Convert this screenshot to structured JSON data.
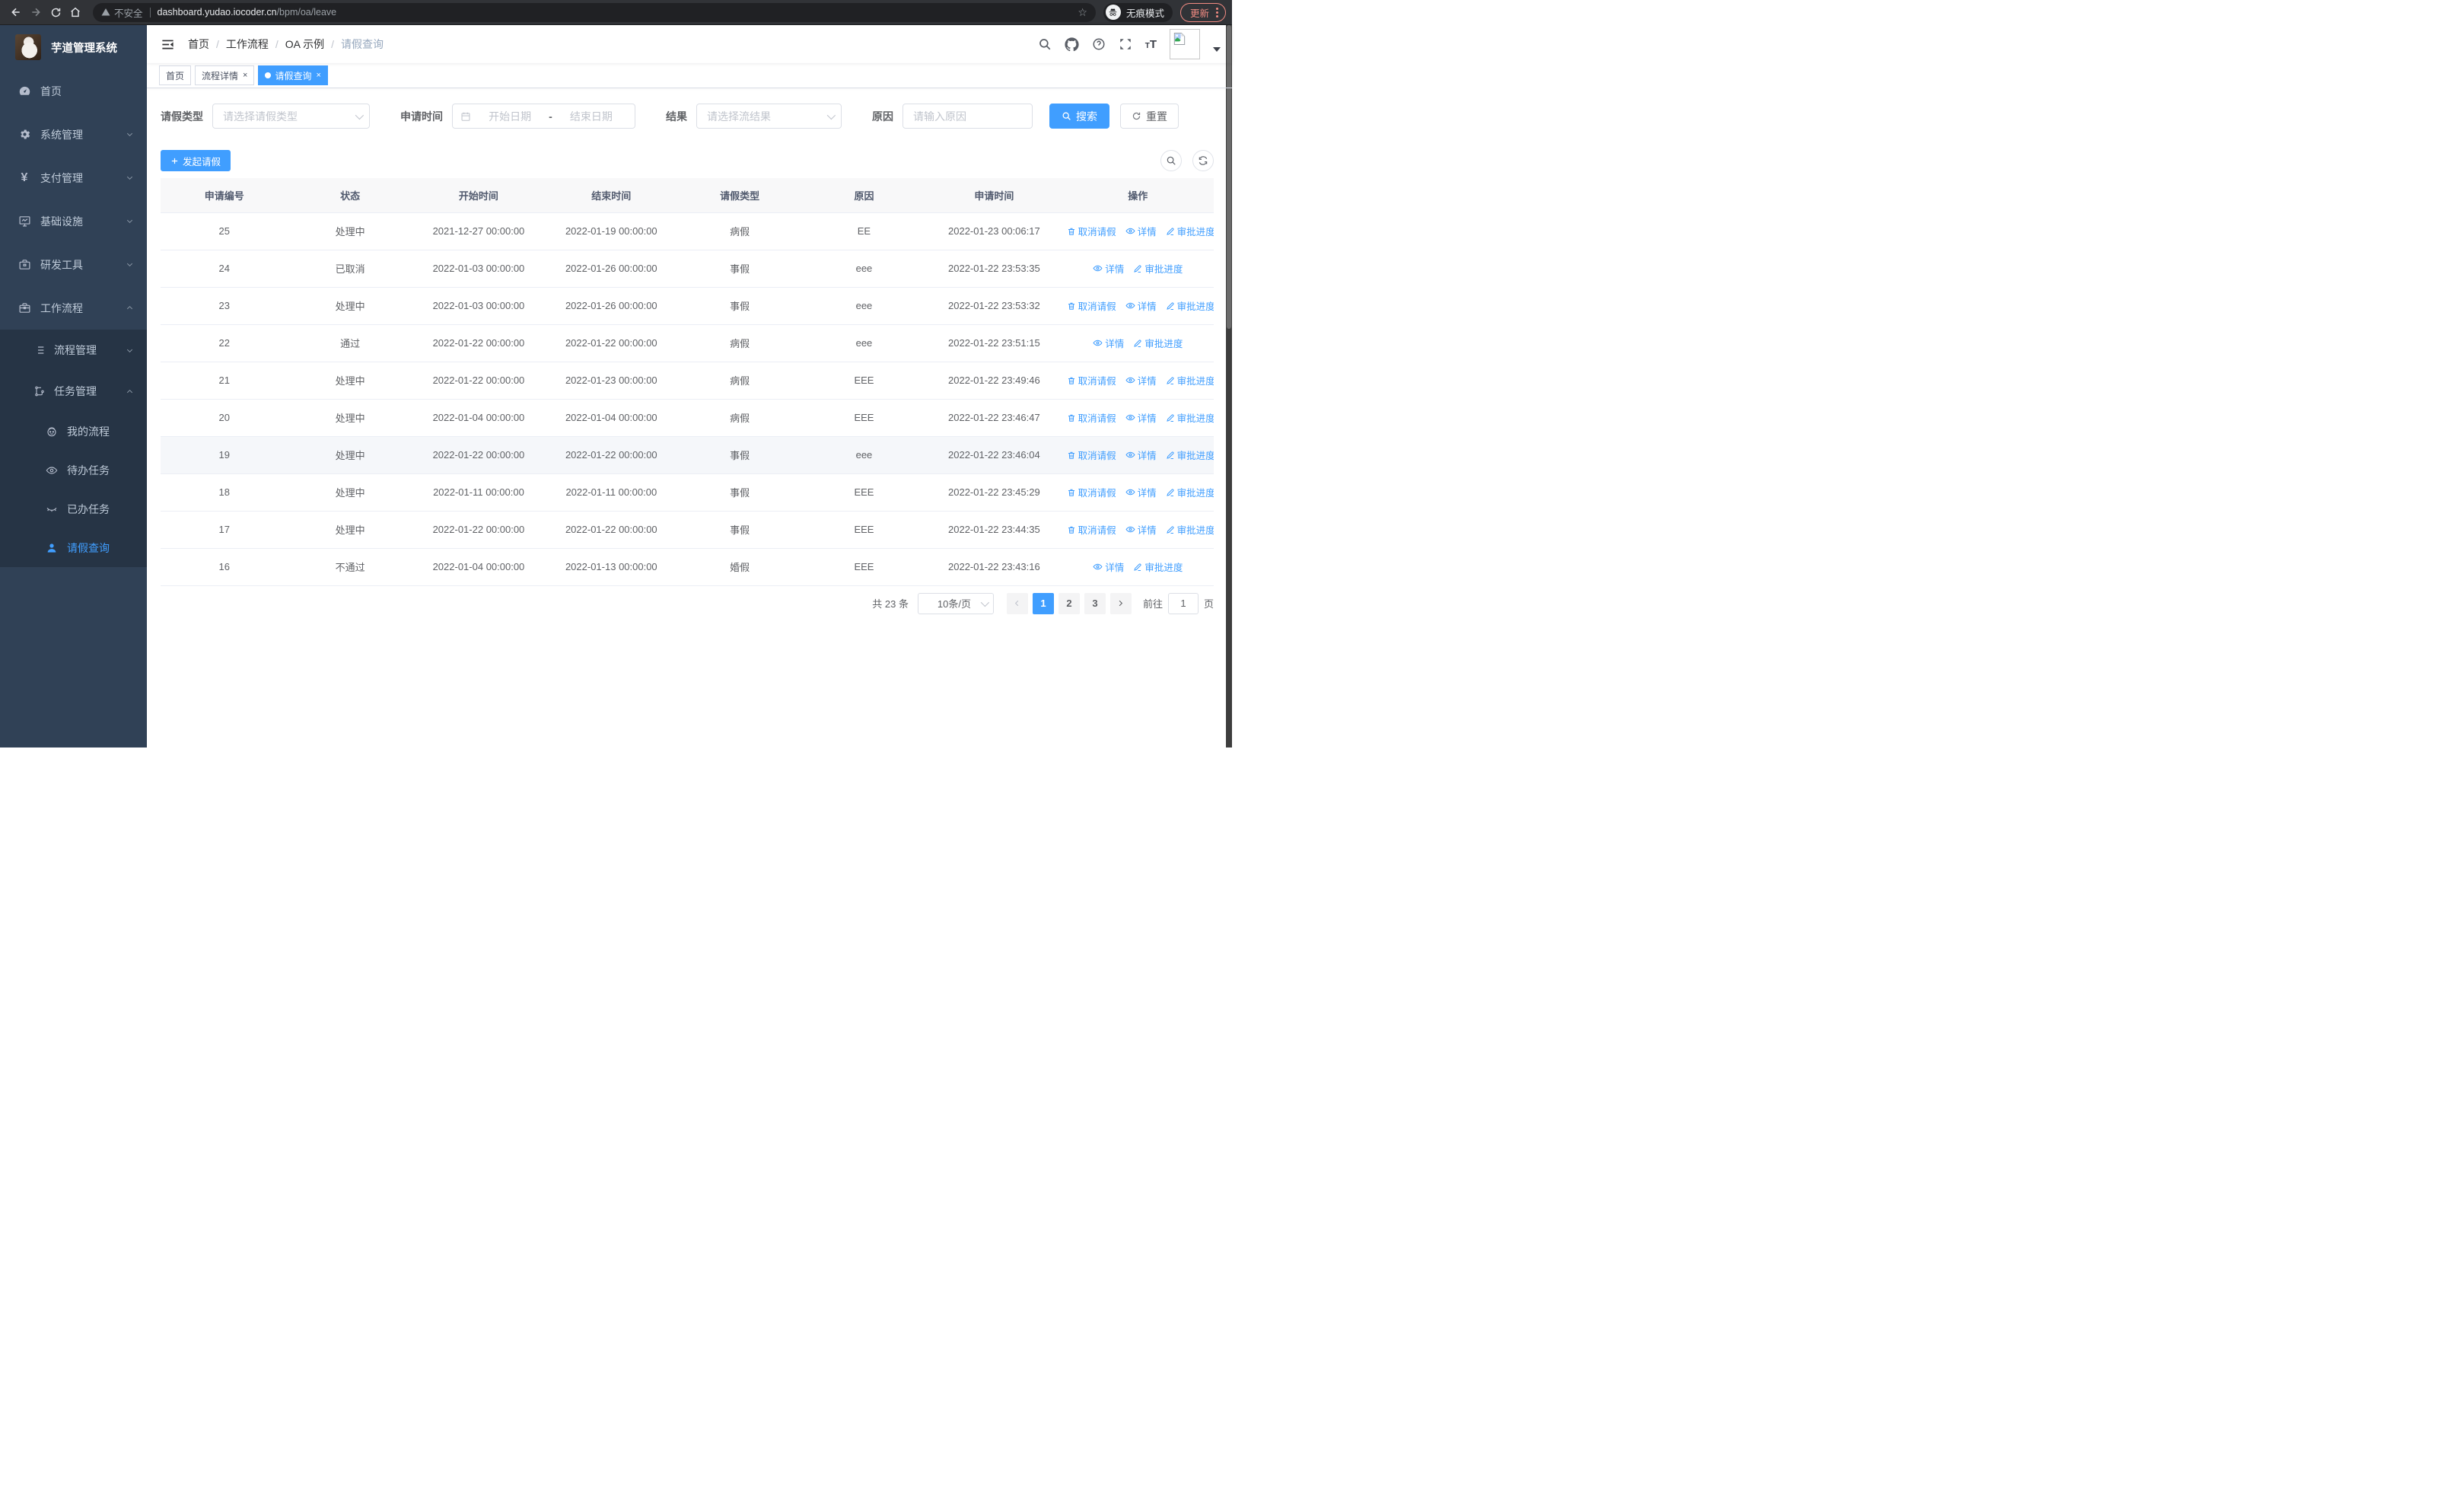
{
  "theme": {
    "accent": "#409eff",
    "sidebar_bg": "#304156",
    "sidebar_sub_bg": "#263445",
    "sidebar_text": "#bfcbd9",
    "chrome_update_color": "#f28b82",
    "table_header_bg": "#f8f8f9"
  },
  "browser": {
    "security_label": "不安全",
    "url_host": "dashboard.yudao.iocoder.cn",
    "url_path": "/bpm/oa/leave",
    "incognito_label": "无痕模式",
    "update_label": "更新"
  },
  "sidebar": {
    "title": "芋道管理系统",
    "items": [
      {
        "label": "首页",
        "icon": "dashboard-icon"
      },
      {
        "label": "系统管理",
        "icon": "gear-icon"
      },
      {
        "label": "支付管理",
        "icon": "yen-icon"
      },
      {
        "label": "基础设施",
        "icon": "monitor-icon"
      },
      {
        "label": "研发工具",
        "icon": "toolbox-icon"
      },
      {
        "label": "工作流程",
        "icon": "briefcase-icon"
      }
    ],
    "sub_items": [
      {
        "label": "流程管理",
        "icon": "list-icon"
      },
      {
        "label": "任务管理",
        "icon": "tree-icon"
      }
    ],
    "leaf_items": [
      {
        "label": "我的流程",
        "icon": "face-icon"
      },
      {
        "label": "待办任务",
        "icon": "eye-open-icon"
      },
      {
        "label": "已办任务",
        "icon": "eye-closed-icon"
      },
      {
        "label": "请假查询",
        "icon": "user-icon",
        "active": true
      }
    ]
  },
  "header": {
    "breadcrumb": [
      "首页",
      "工作流程",
      "OA 示例",
      "请假查询"
    ]
  },
  "tabs": [
    {
      "label": "首页"
    },
    {
      "label": "流程详情",
      "closable": true
    },
    {
      "label": "请假查询",
      "closable": true,
      "active": true
    }
  ],
  "filters": {
    "leave_type_label": "请假类型",
    "leave_type_placeholder": "请选择请假类型",
    "apply_time_label": "申请时间",
    "date_start_placeholder": "开始日期",
    "date_separator": "-",
    "date_end_placeholder": "结束日期",
    "result_label": "结果",
    "result_placeholder": "请选择流结果",
    "reason_label": "原因",
    "reason_placeholder": "请输入原因",
    "search_label": "搜索",
    "reset_label": "重置"
  },
  "toolbar": {
    "create_label": "发起请假"
  },
  "table": {
    "headers": [
      "申请编号",
      "状态",
      "开始时间",
      "结束时间",
      "请假类型",
      "原因",
      "申请时间",
      "操作"
    ],
    "action_labels": {
      "cancel": "取消请假",
      "detail": "详情",
      "progress": "审批进度"
    },
    "rows": [
      {
        "id": "25",
        "status": "处理中",
        "start": "2021-12-27 00:00:00",
        "end": "2022-01-19 00:00:00",
        "type": "病假",
        "reason": "EE",
        "applied": "2022-01-23 00:06:17",
        "actions": [
          "cancel",
          "detail",
          "progress"
        ]
      },
      {
        "id": "24",
        "status": "已取消",
        "start": "2022-01-03 00:00:00",
        "end": "2022-01-26 00:00:00",
        "type": "事假",
        "reason": "eee",
        "applied": "2022-01-22 23:53:35",
        "actions": [
          "detail",
          "progress"
        ]
      },
      {
        "id": "23",
        "status": "处理中",
        "start": "2022-01-03 00:00:00",
        "end": "2022-01-26 00:00:00",
        "type": "事假",
        "reason": "eee",
        "applied": "2022-01-22 23:53:32",
        "actions": [
          "cancel",
          "detail",
          "progress"
        ]
      },
      {
        "id": "22",
        "status": "通过",
        "start": "2022-01-22 00:00:00",
        "end": "2022-01-22 00:00:00",
        "type": "病假",
        "reason": "eee",
        "applied": "2022-01-22 23:51:15",
        "actions": [
          "detail",
          "progress"
        ]
      },
      {
        "id": "21",
        "status": "处理中",
        "start": "2022-01-22 00:00:00",
        "end": "2022-01-23 00:00:00",
        "type": "病假",
        "reason": "EEE",
        "applied": "2022-01-22 23:49:46",
        "actions": [
          "cancel",
          "detail",
          "progress"
        ]
      },
      {
        "id": "20",
        "status": "处理中",
        "start": "2022-01-04 00:00:00",
        "end": "2022-01-04 00:00:00",
        "type": "病假",
        "reason": "EEE",
        "applied": "2022-01-22 23:46:47",
        "actions": [
          "cancel",
          "detail",
          "progress"
        ]
      },
      {
        "id": "19",
        "status": "处理中",
        "start": "2022-01-22 00:00:00",
        "end": "2022-01-22 00:00:00",
        "type": "事假",
        "reason": "eee",
        "applied": "2022-01-22 23:46:04",
        "actions": [
          "cancel",
          "detail",
          "progress"
        ],
        "highlighted": true
      },
      {
        "id": "18",
        "status": "处理中",
        "start": "2022-01-11 00:00:00",
        "end": "2022-01-11 00:00:00",
        "type": "事假",
        "reason": "EEE",
        "applied": "2022-01-22 23:45:29",
        "actions": [
          "cancel",
          "detail",
          "progress"
        ]
      },
      {
        "id": "17",
        "status": "处理中",
        "start": "2022-01-22 00:00:00",
        "end": "2022-01-22 00:00:00",
        "type": "事假",
        "reason": "EEE",
        "applied": "2022-01-22 23:44:35",
        "actions": [
          "cancel",
          "detail",
          "progress"
        ]
      },
      {
        "id": "16",
        "status": "不通过",
        "start": "2022-01-04 00:00:00",
        "end": "2022-01-13 00:00:00",
        "type": "婚假",
        "reason": "EEE",
        "applied": "2022-01-22 23:43:16",
        "actions": [
          "detail",
          "progress"
        ]
      }
    ]
  },
  "pagination": {
    "total": "共 23 条",
    "page_size": "10条/页",
    "pages": [
      "1",
      "2",
      "3"
    ],
    "active_page": "1",
    "goto_label": "前往",
    "goto_value": "1",
    "goto_unit": "页"
  }
}
